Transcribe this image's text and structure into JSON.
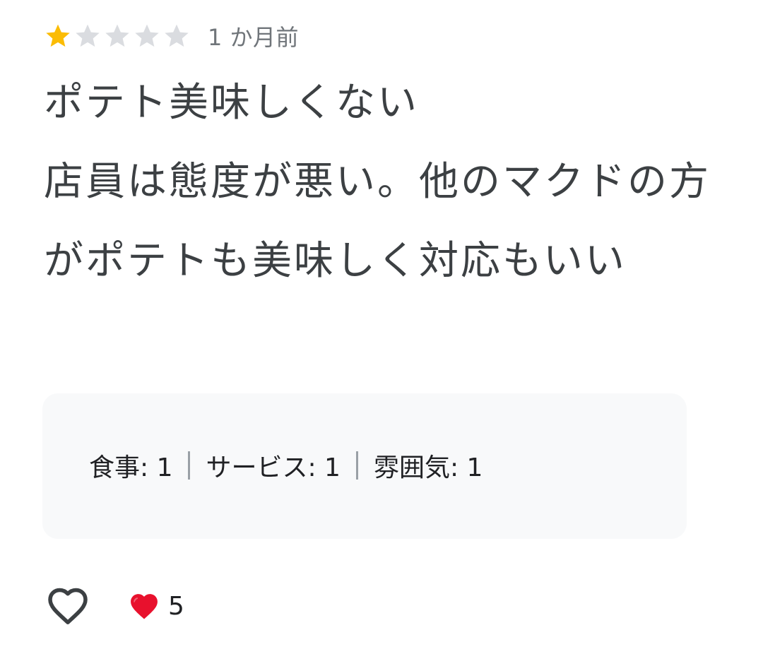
{
  "review": {
    "rating": 1,
    "max_rating": 5,
    "time_ago": "1 か月前",
    "text": "ポテト美味しくない\n店員は態度が悪い。他のマクドの方がポテトも美味しく対応もいい"
  },
  "ratings": {
    "food_label": "食事: 1",
    "service_label": "サービス: 1",
    "atmosphere_label": "雰囲気: 1"
  },
  "actions": {
    "like_icon": "heart-outline-icon",
    "reaction_icon": "red-heart-icon",
    "reaction_count": "5"
  },
  "colors": {
    "star_filled": "#fbbc04",
    "star_empty": "#dadce0",
    "text_primary": "#3c4043",
    "text_secondary": "#70757a",
    "box_background": "#f8f9fa",
    "heart_red": "#e8112d"
  }
}
